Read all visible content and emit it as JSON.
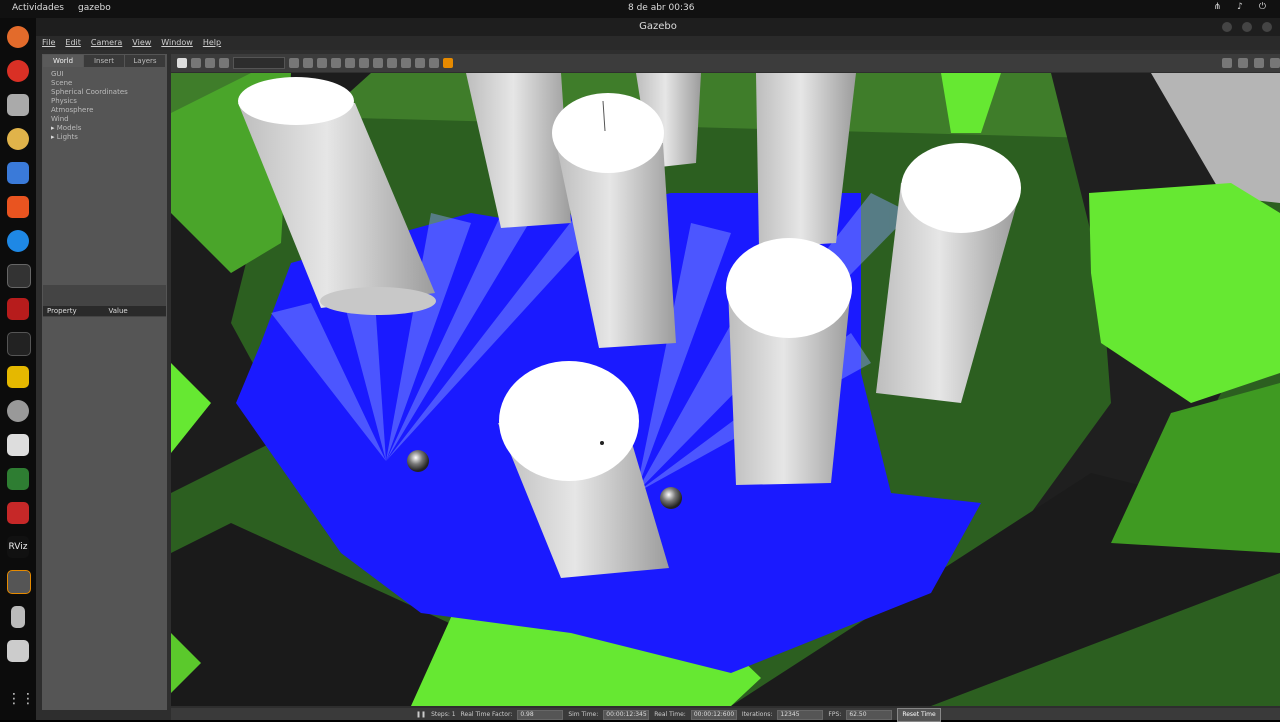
{
  "topbar": {
    "activities": "Actividades",
    "app_name": "gazebo",
    "clock": "8 de abr  00:36"
  },
  "window": {
    "title": "Gazebo"
  },
  "menu": [
    "File",
    "Edit",
    "Camera",
    "View",
    "Window",
    "Help"
  ],
  "left_panel": {
    "tabs": [
      "World",
      "Insert",
      "Layers"
    ],
    "active_tab": "World",
    "tree": [
      {
        "label": "GUI",
        "expandable": false
      },
      {
        "label": "Scene",
        "expandable": false
      },
      {
        "label": "Spherical Coordinates",
        "expandable": false
      },
      {
        "label": "Physics",
        "expandable": false
      },
      {
        "label": "Atmosphere",
        "expandable": false
      },
      {
        "label": "Wind",
        "expandable": false
      },
      {
        "label": "Models",
        "expandable": true
      },
      {
        "label": "Lights",
        "expandable": true
      }
    ],
    "props_header": {
      "property": "Property",
      "value": "Value"
    }
  },
  "status": {
    "step_label": "Steps: 1",
    "rtf_label": "Real Time Factor:",
    "rtf_value": "0.98",
    "sim_label": "Sim Time:",
    "sim_value": "00:00:12:345",
    "real_label": "Real Time:",
    "real_value": "00:00:12:600",
    "iter_label": "Iterations:",
    "iter_value": "12345",
    "fps_label": "FPS:",
    "fps_value": "62.50",
    "reset_label": "Reset Time"
  },
  "colors": {
    "floor_blue": "#1a1aff",
    "pillar": "#e8e8e8",
    "wall_dark": "#1f1f1f",
    "hex_green": "#66e832",
    "accent_orange": "#e68a00"
  }
}
